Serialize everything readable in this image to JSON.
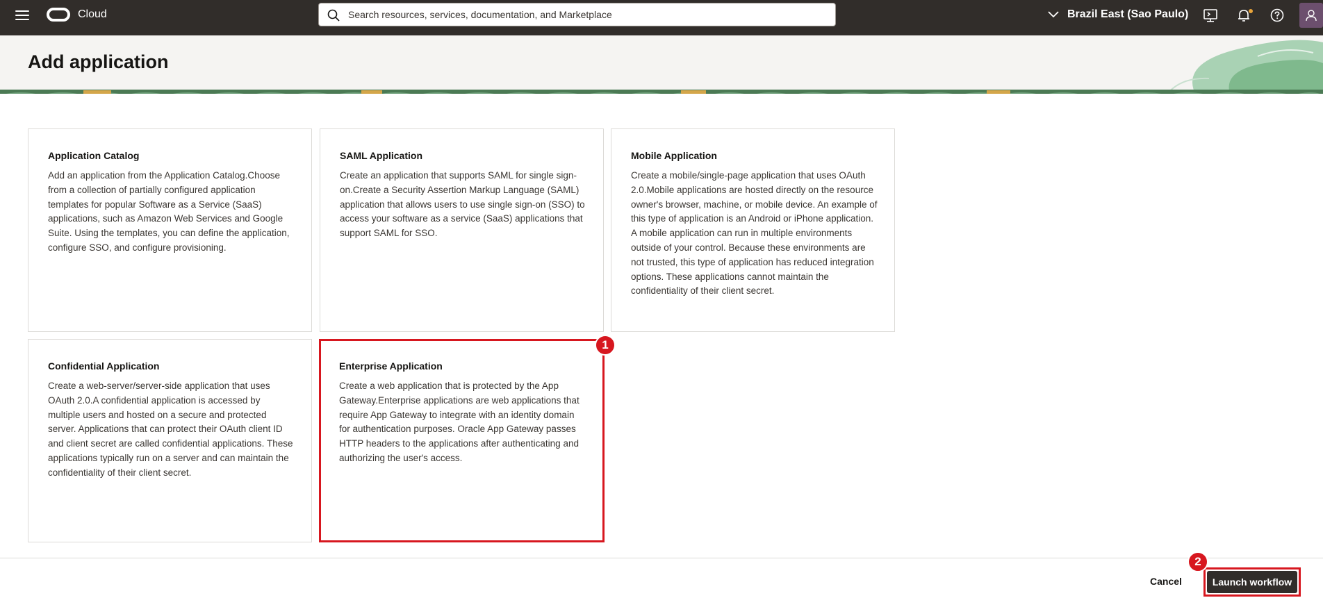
{
  "topbar": {
    "brand": "Cloud",
    "search_placeholder": "Search resources, services, documentation, and Marketplace",
    "region": "Brazil East (Sao Paulo)"
  },
  "header": {
    "title": "Add application"
  },
  "cards": [
    {
      "title": "Application Catalog",
      "description": "Add an application from the Application Catalog.Choose from a collection of partially configured application templates for popular Software as a Service (SaaS) applications, such as Amazon Web Services and Google Suite. Using the templates, you can define the application, configure SSO, and configure provisioning."
    },
    {
      "title": "SAML Application",
      "description": "Create an application that supports SAML for single sign-on.Create a Security Assertion Markup Language (SAML) application that allows users to use single sign-on (SSO) to access your software as a service (SaaS) applications that support SAML for SSO."
    },
    {
      "title": "Mobile Application",
      "description": "Create a mobile/single-page application that uses OAuth 2.0.Mobile applications are hosted directly on the resource owner's browser, machine, or mobile device. An example of this type of application is an Android or iPhone application. A mobile application can run in multiple environments outside of your control. Because these environments are not trusted, this type of application has reduced integration options. These applications cannot maintain the confidentiality of their client secret."
    },
    {
      "title": "Confidential Application",
      "description": "Create a web-server/server-side application that uses OAuth 2.0.A confidential application is accessed by multiple users and hosted on a secure and protected server. Applications that can protect their OAuth client ID and client secret are called confidential applications. These applications typically run on a server and can maintain the confidentiality of their client secret."
    },
    {
      "title": "Enterprise Application",
      "description": "Create a web application that is protected by the App Gateway.Enterprise applications are web applications that require App Gateway to integrate with an identity domain for authentication purposes. Oracle App Gateway passes HTTP headers to the applications after authenticating and authorizing the user's access."
    }
  ],
  "annotations": {
    "step1": "1",
    "step2": "2"
  },
  "footer": {
    "cancel_label": "Cancel",
    "launch_label": "Launch workflow"
  },
  "colors": {
    "topbar": "#312d2a",
    "highlight": "#d7171f",
    "header_band": "#f5f4f2",
    "primary_button": "#312d2a"
  }
}
